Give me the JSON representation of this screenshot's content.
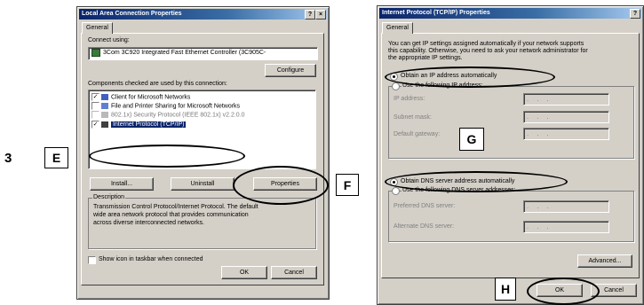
{
  "step_number": "3",
  "callouts": {
    "e": "E",
    "f": "F",
    "g": "G",
    "h": "H"
  },
  "lan_dialog": {
    "title": "Local Area Connection Properties",
    "help": "?",
    "close": "×",
    "tab_general": "General",
    "connect_using_label": "Connect using:",
    "adapter": "3Com 3C920 Integrated Fast Ethernet Controller (3C905C-",
    "configure": "Configure",
    "components_label": "Components checked are used by this connection:",
    "components": [
      {
        "label": "Client for Microsoft Networks",
        "checked": true
      },
      {
        "label": "File and Printer Sharing for Microsoft Networks",
        "checked": false
      },
      {
        "label": "802.1x) Security Protocol (IEEE 802.1x) v2.2.0.0",
        "checked": false
      },
      {
        "label": "Internet Protocol (TCP/IP)",
        "checked": true
      }
    ],
    "install": "Install...",
    "uninstall": "Uninstall",
    "properties": "Properties",
    "description_label": "Description",
    "description": [
      "Transmission Control Protocol/Internet Protocol. The default",
      "wide area network protocol that provides communication",
      "across diverse interconnected networks."
    ],
    "show_icon": "Show icon in taskbar when connected",
    "ok": "OK",
    "cancel": "Cancel"
  },
  "tcp_dialog": {
    "title": "Internet Protocol (TCP/IP) Properties",
    "help": "?",
    "tab_general": "General",
    "intro": [
      "You can get IP settings assigned automatically if your network supports",
      "this capability. Otherwise, you need to ask your network administrator for",
      "the appropriate IP settings."
    ],
    "obtain_ip": "Obtain an IP address automatically",
    "use_ip": "Use the following IP address:",
    "ip_address": "IP address:",
    "subnet_mask": "Subnet mask:",
    "default_gateway": "Default gateway:",
    "dots": "...",
    "obtain_dns": "Obtain DNS server address automatically",
    "use_dns": "Use the following DNS server addresses:",
    "preferred_dns": "Preferred DNS server:",
    "alternate_dns": "Alternate DNS server:",
    "advanced": "Advanced...",
    "ok": "OK",
    "cancel": "Cancel"
  }
}
